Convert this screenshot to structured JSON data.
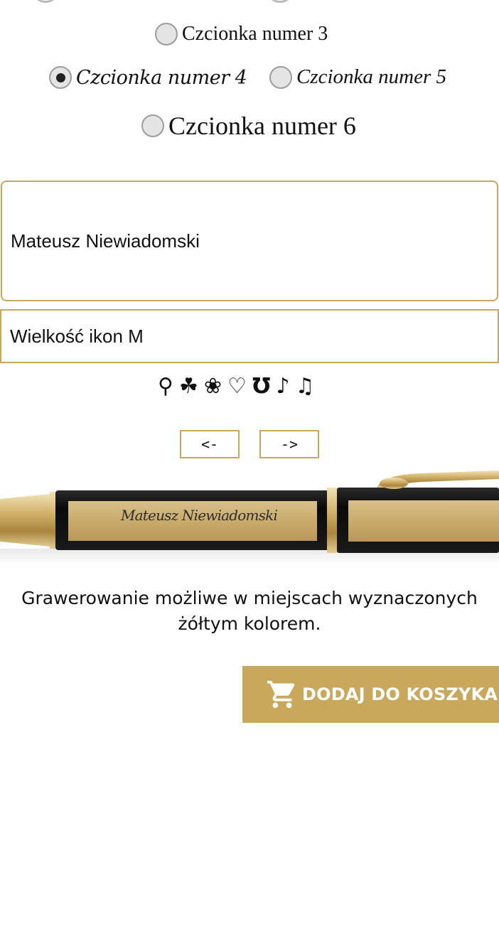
{
  "font_options": [
    {
      "label": "Czcionka numer 3",
      "selected": false
    },
    {
      "label": "Czcionka numer 4",
      "selected": true
    },
    {
      "label": "Czcionka numer 5",
      "selected": false
    },
    {
      "label": "Czcionka numer 6",
      "selected": false
    }
  ],
  "engraving_text": {
    "value": "Mateusz Niewiadomski"
  },
  "icon_size_select": {
    "selected": "Wielkość ikon M"
  },
  "icons": [
    {
      "glyph": "⚲",
      "name": "balloon-icon"
    },
    {
      "glyph": "☘",
      "name": "clover-icon"
    },
    {
      "glyph": "❀",
      "name": "flower-icon"
    },
    {
      "glyph": "♡",
      "name": "heart-icon"
    },
    {
      "glyph": "Ʊ",
      "name": "horseshoe-icon"
    },
    {
      "glyph": "♪",
      "name": "eighth-note-icon"
    },
    {
      "glyph": "♫",
      "name": "beamed-notes-icon"
    }
  ],
  "nav": {
    "prev": "<-",
    "next": "->"
  },
  "preview": {
    "engraving": "Mateusz Niewiadomski"
  },
  "info_text": "Grawerowanie możliwe w miejscach wyznaczonych żółtym kolorem.",
  "cart_button": {
    "label": "DODAJ DO KOSZYKA",
    "icon": "cart-icon"
  },
  "colors": {
    "accent": "#c9a85c",
    "pen_black": "#111111",
    "gold": "#c8ac6e"
  }
}
